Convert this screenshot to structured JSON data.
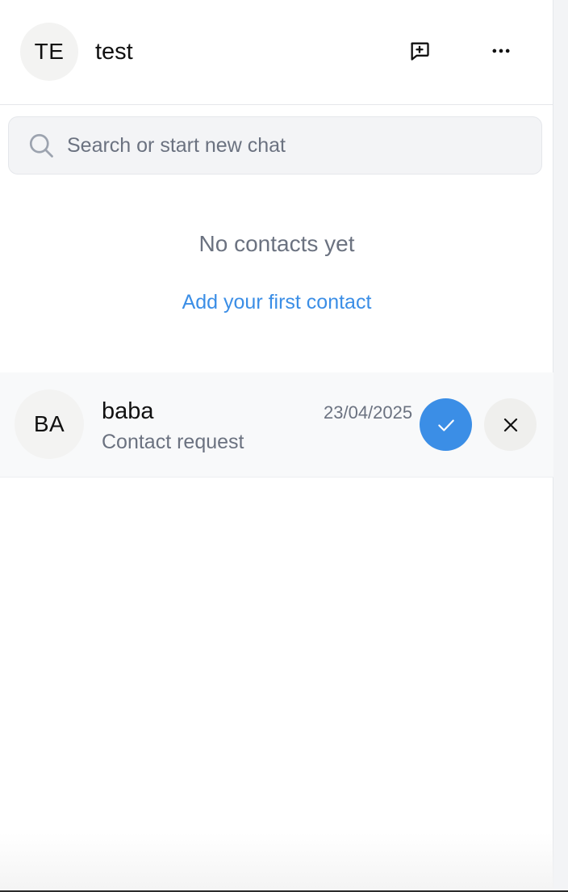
{
  "header": {
    "avatar_initials": "TE",
    "username": "test",
    "new_chat_icon": "message-square-plus-icon",
    "more_icon": "more-horizontal-icon"
  },
  "search": {
    "placeholder": "Search or start new chat",
    "value": "",
    "icon": "search-icon"
  },
  "empty_state": {
    "title": "No contacts yet",
    "action_label": "Add your first contact"
  },
  "requests": [
    {
      "avatar_initials": "BA",
      "name": "baba",
      "subtitle": "Contact request",
      "date": "23/04/2025",
      "accept_icon": "check-icon",
      "reject_icon": "close-icon"
    }
  ],
  "colors": {
    "accent": "#3b8ee6",
    "muted_text": "#6b7280",
    "avatar_bg": "#f3f3f2",
    "row_bg": "#f8f9fa"
  }
}
